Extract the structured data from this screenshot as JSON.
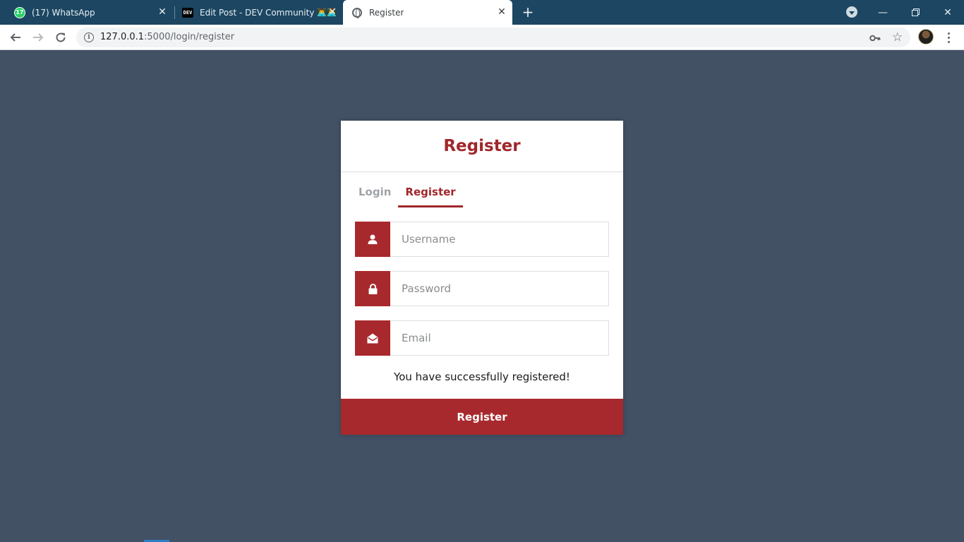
{
  "browser": {
    "tabs": [
      {
        "title": "(17) WhatsApp",
        "badge": "17",
        "icon": "whatsapp-icon"
      },
      {
        "title": "Edit Post - DEV Community",
        "icon": "dev-icon",
        "emoji": "👨‍💻👨‍💻"
      },
      {
        "title": "Register",
        "icon": "globe-icon",
        "active": true
      }
    ],
    "url_host": "127.0.0.1",
    "url_rest": ":5000/login/register"
  },
  "page": {
    "card_title": "Register",
    "tabs": {
      "login": "Login",
      "register": "Register"
    },
    "fields": {
      "username_placeholder": "Username",
      "password_placeholder": "Password",
      "email_placeholder": "Email"
    },
    "message": "You have successfully registered!",
    "submit_label": "Register"
  },
  "colors": {
    "accent": "#a8292d",
    "background": "#435165",
    "tabbar": "#1c4661",
    "inactive_tab": "#9fa3a7"
  }
}
